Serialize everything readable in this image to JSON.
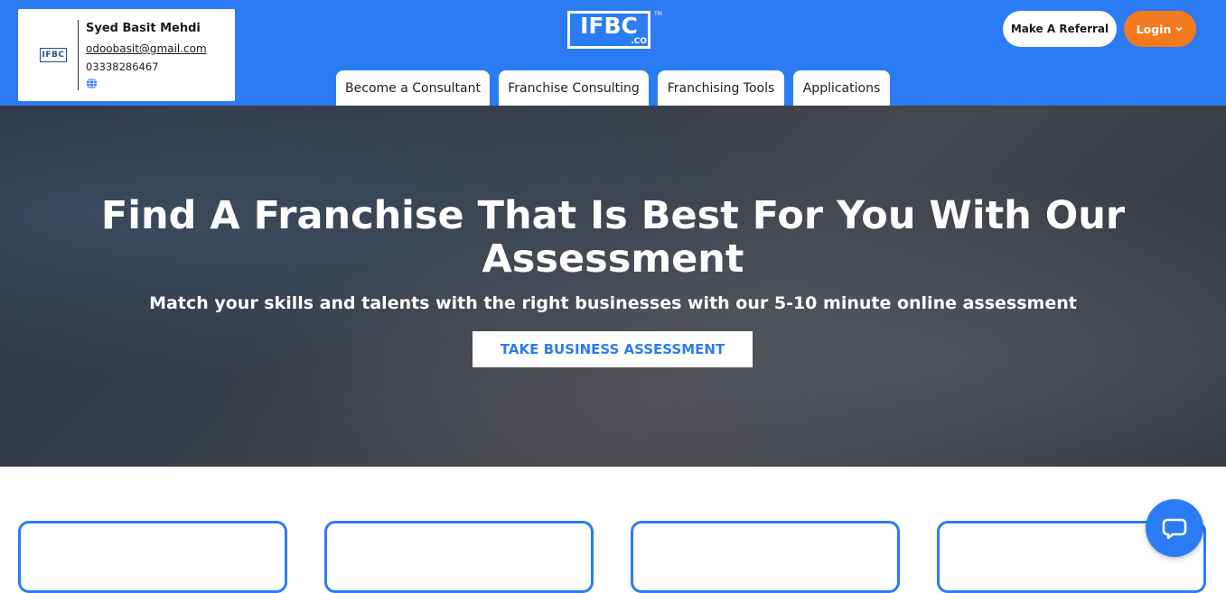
{
  "profile_card": {
    "logo_text": "IFBC",
    "name": "Syed Basit Mehdi",
    "email": "odoobasit@gmail.com",
    "phone": "03338286467",
    "icon": "globe-icon"
  },
  "brand": {
    "logo_text": "IFBC",
    "logo_sub": ".CO",
    "logo_tm": "TM"
  },
  "nav": {
    "tabs": [
      {
        "label": "Become a Consultant"
      },
      {
        "label": "Franchise Consulting"
      },
      {
        "label": "Franchising Tools"
      },
      {
        "label": "Applications"
      }
    ]
  },
  "actions": {
    "referral_label": "Make A Referral",
    "login_label": "Login",
    "login_icon": "chevron-down-icon"
  },
  "hero": {
    "title": "Find A Franchise That Is Best For You With Our Assessment",
    "subtitle": "Match your skills and talents with the right businesses with our 5-10 minute online assessment",
    "cta_label": "TAKE BUSINESS ASSESSMENT"
  },
  "chat": {
    "icon": "chat-bubble-icon"
  },
  "colors": {
    "brand_blue": "#2b7cf3",
    "login_orange": "#f47a20"
  }
}
